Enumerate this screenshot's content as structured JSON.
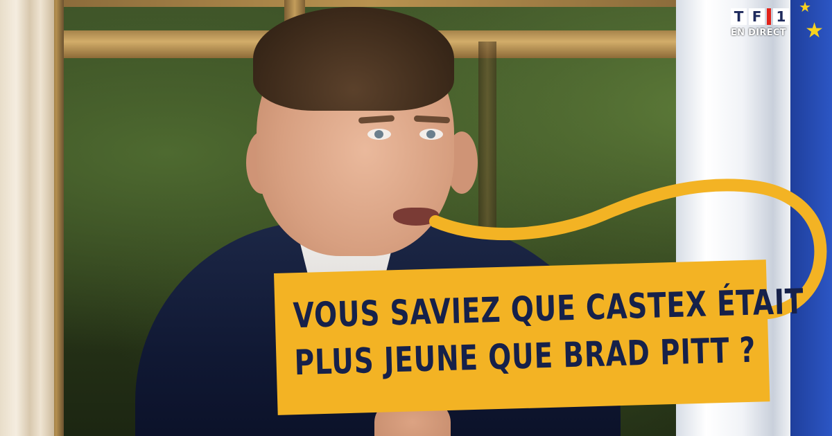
{
  "broadcaster": {
    "logo_text": "TF1",
    "live_label": "EN DIRECT"
  },
  "caption": {
    "line1": "VOUS SAVIEZ QUE CASTEX ÉTAIT",
    "line2": "PLUS JEUNE QUE BRAD PITT ?",
    "background_color": "#F3B324",
    "text_color": "#16214A"
  },
  "speech_line_color": "#F3B324"
}
